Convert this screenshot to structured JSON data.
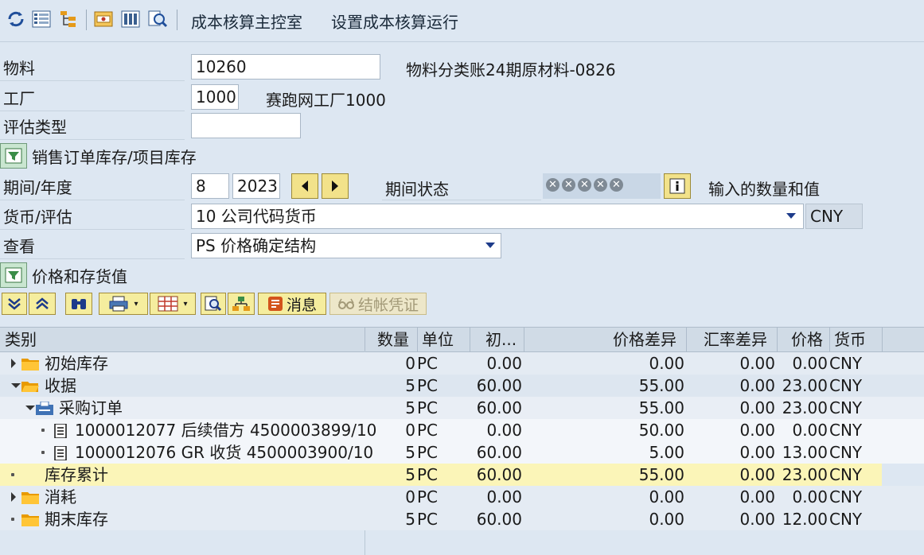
{
  "toolbar": {
    "icons": [
      "refresh-icon",
      "list-icon",
      "tree-icon",
      "display-icon",
      "columns-icon",
      "search-settings-icon"
    ],
    "link_cost_cockpit": "成本核算主控室",
    "link_setup_run": "设置成本核算运行"
  },
  "form": {
    "material_label": "物料",
    "material_value": "10260",
    "material_desc": "物料分类账24期原材料-0826",
    "plant_label": "工厂",
    "plant_value": "1000",
    "plant_desc": "赛跑网工厂1000",
    "valuation_type_label": "评估类型",
    "valuation_type_value": "",
    "sales_order_stock_label": "销售订单库存/项目库存",
    "period_year_label": "期间/年度",
    "period_value": "8",
    "year_value": "2023",
    "period_status_label": "期间状态",
    "period_status_text": "输入的数量和值",
    "currency_valuation_label": "货币/评估",
    "currency_valuation_value": "10 公司代码货币",
    "currency_code": "CNY",
    "view_label": "查看",
    "view_value": "PS 价格确定结构",
    "price_stock_label": "价格和存货值"
  },
  "alv_toolbar": {
    "message_label": "消息",
    "closing_document_label": "结帐凭证"
  },
  "grid": {
    "columns": {
      "category": "类别",
      "quantity": "数量",
      "unit": "单位",
      "initial": "初...",
      "price_diff": "价格差异",
      "exchange_diff": "汇率差异",
      "price": "价格",
      "currency": "货币"
    },
    "rows": [
      {
        "label": "初始库存",
        "qty": "0",
        "unit": "PC",
        "initial": "0.00",
        "price_diff": "0.00",
        "exch_diff": "0.00",
        "price": "0.00",
        "currency": "CNY"
      },
      {
        "label": "收据",
        "qty": "5",
        "unit": "PC",
        "initial": "60.00",
        "price_diff": "55.00",
        "exch_diff": "0.00",
        "price": "23.00",
        "currency": "CNY"
      },
      {
        "label": "采购订单",
        "qty": "5",
        "unit": "PC",
        "initial": "60.00",
        "price_diff": "55.00",
        "exch_diff": "0.00",
        "price": "23.00",
        "currency": "CNY"
      },
      {
        "label": "1000012077 后续借方 4500003899/10",
        "qty": "0",
        "unit": "PC",
        "initial": "0.00",
        "price_diff": "50.00",
        "exch_diff": "0.00",
        "price": "0.00",
        "currency": "CNY"
      },
      {
        "label": "1000012076 GR 收货 4500003900/10",
        "qty": "5",
        "unit": "PC",
        "initial": "60.00",
        "price_diff": "5.00",
        "exch_diff": "0.00",
        "price": "13.00",
        "currency": "CNY"
      },
      {
        "label": "库存累计",
        "qty": "5",
        "unit": "PC",
        "initial": "60.00",
        "price_diff": "55.00",
        "exch_diff": "0.00",
        "price": "23.00",
        "currency": "CNY"
      },
      {
        "label": "消耗",
        "qty": "0",
        "unit": "PC",
        "initial": "0.00",
        "price_diff": "0.00",
        "exch_diff": "0.00",
        "price": "0.00",
        "currency": "CNY"
      },
      {
        "label": "期末库存",
        "qty": "5",
        "unit": "PC",
        "initial": "60.00",
        "price_diff": "0.00",
        "exch_diff": "0.00",
        "price": "12.00",
        "currency": "CNY"
      }
    ]
  },
  "colors": {
    "background": "#dde7f2",
    "highlight_row": "#fbf5b8",
    "button_yellow": "#f5ed9e",
    "folder": "#f2a900"
  }
}
